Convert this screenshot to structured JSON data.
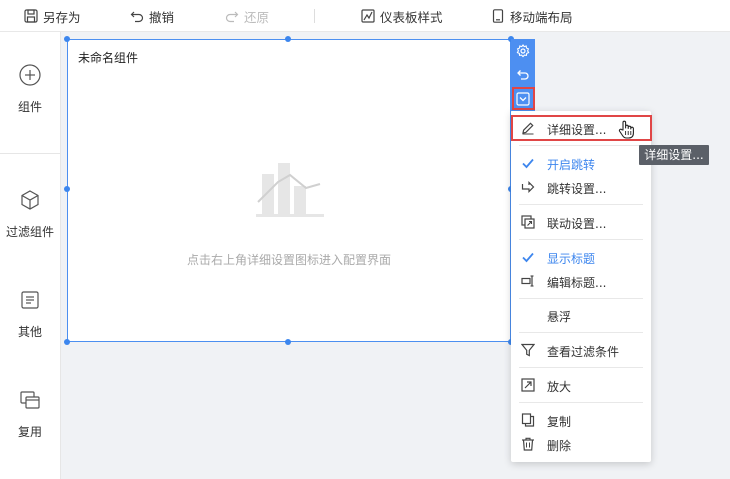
{
  "toolbar": {
    "save_as": "另存为",
    "undo": "撤销",
    "redo": "还原",
    "dashboard_style": "仪表板样式",
    "mobile_layout": "移动端布局"
  },
  "left_panel": {
    "components": "组件",
    "filter_components": "过滤组件",
    "other": "其他",
    "reuse": "复用"
  },
  "widget": {
    "title": "未命名组件",
    "placeholder": "点击右上角详细设置图标进入配置界面"
  },
  "menu": {
    "detail_settings": "详细设置...",
    "enable_jump": "开启跳转",
    "jump_settings": "跳转设置...",
    "linkage_settings": "联动设置...",
    "show_title": "显示标题",
    "edit_title": "编辑标题...",
    "float": "悬浮",
    "view_filter_conditions": "查看过滤条件",
    "zoom_in": "放大",
    "copy": "复制",
    "delete": "删除"
  },
  "tooltip": "详细设置...",
  "colors": {
    "accent": "#3d86ee",
    "highlight": "#e04646"
  }
}
